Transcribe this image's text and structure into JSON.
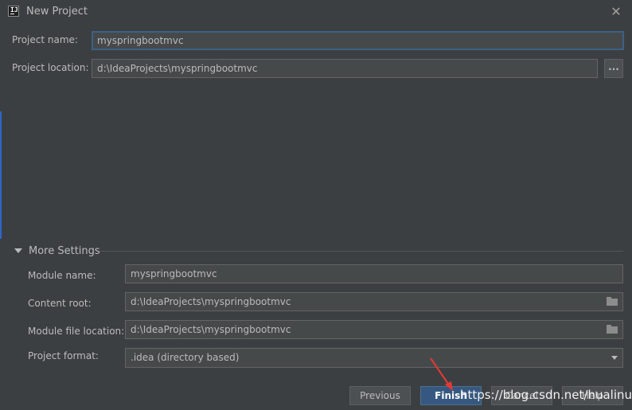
{
  "window": {
    "title": "New Project",
    "close_glyph": "✕",
    "app_icon_text": "IJ"
  },
  "project": {
    "name_label": "Project name:",
    "name_value": "myspringbootmvc",
    "location_label": "Project location:",
    "location_value": "d:\\IdeaProjects\\myspringbootmvc",
    "browse_label": "..."
  },
  "more_settings": {
    "title": "More Settings",
    "module_name_label": "Module name:",
    "module_name_value": "myspringbootmvc",
    "content_root_label": "Content root:",
    "content_root_value": "d:\\IdeaProjects\\myspringbootmvc",
    "module_file_label": "Module file location:",
    "module_file_value": "d:\\IdeaProjects\\myspringbootmvc",
    "format_label": "Project format:",
    "format_value": ".idea (directory based)"
  },
  "buttons": {
    "previous": "Previous",
    "finish": "Finish",
    "cancel": "Cancel",
    "help": "Help"
  },
  "watermark": "https://blog.csdn.net/hualinux",
  "colors": {
    "background": "#3c3f41",
    "field": "#45494a",
    "accent": "#365880",
    "annotation_arrow": "#e53935"
  },
  "icons": [
    "app-logo-icon",
    "close-icon",
    "folder-icon",
    "chevron-down-icon",
    "disclosure-triangle-icon"
  ]
}
